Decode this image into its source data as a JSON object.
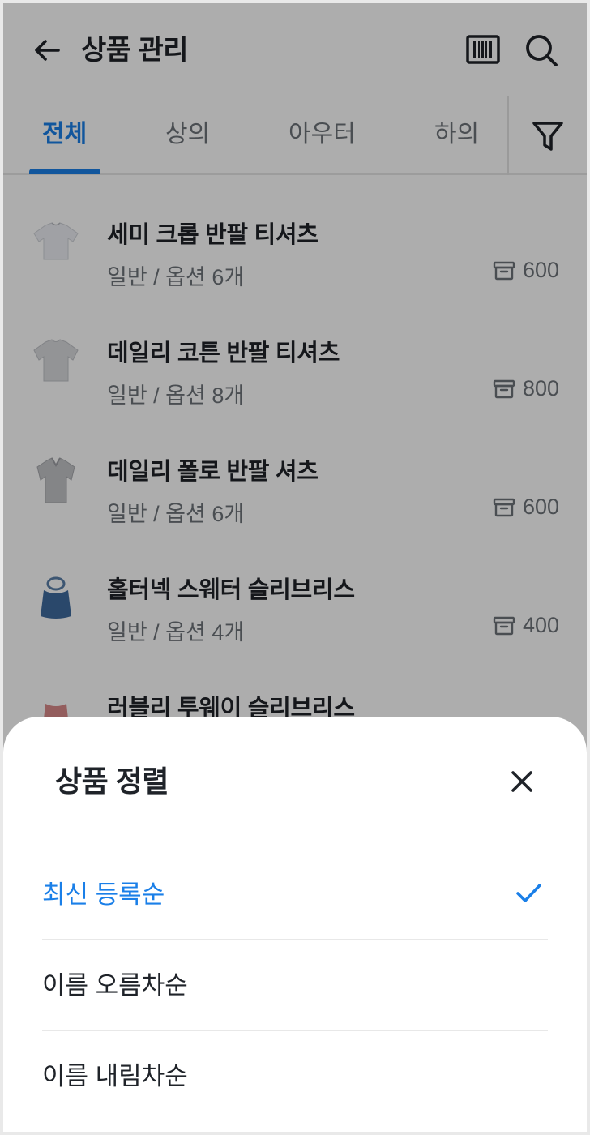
{
  "header": {
    "title": "상품 관리",
    "back_icon": "arrow-left-icon",
    "barcode_icon": "barcode-icon",
    "search_icon": "search-icon"
  },
  "tabs": {
    "items": [
      {
        "label": "전체",
        "active": true
      },
      {
        "label": "상의",
        "active": false
      },
      {
        "label": "아우터",
        "active": false
      },
      {
        "label": "하의",
        "active": false
      }
    ],
    "filter_icon": "filter-icon"
  },
  "products": [
    {
      "name": "세미 크롭 반팔 티셔츠",
      "meta": "일반 / 옵션 6개",
      "stock": "600",
      "thumb": "tshirt-icon"
    },
    {
      "name": "데일리 코튼 반팔 티셔츠",
      "meta": "일반 / 옵션 8개",
      "stock": "800",
      "thumb": "tshirt-icon"
    },
    {
      "name": "데일리 폴로 반팔 셔츠",
      "meta": "일반 / 옵션 6개",
      "stock": "600",
      "thumb": "polo-shirt-icon"
    },
    {
      "name": "홀터넥 스웨터 슬리브리스",
      "meta": "일반 / 옵션 4개",
      "stock": "400",
      "thumb": "sleeveless-icon"
    },
    {
      "name": "러블리 투웨이 슬리브리스",
      "meta": "",
      "stock": "",
      "thumb": "sleeveless-icon"
    }
  ],
  "sort_sheet": {
    "title": "상품 정렬",
    "close_icon": "close-icon",
    "options": [
      {
        "label": "최신 등록순",
        "selected": true
      },
      {
        "label": "이름 오름차순",
        "selected": false
      },
      {
        "label": "이름 내림차순",
        "selected": false
      }
    ],
    "check_icon": "check-icon"
  },
  "colors": {
    "accent": "#1a7fe8",
    "text_primary": "#1f2329",
    "text_secondary": "#6e737a",
    "overlay": "rgba(0,0,0,0.32)"
  }
}
